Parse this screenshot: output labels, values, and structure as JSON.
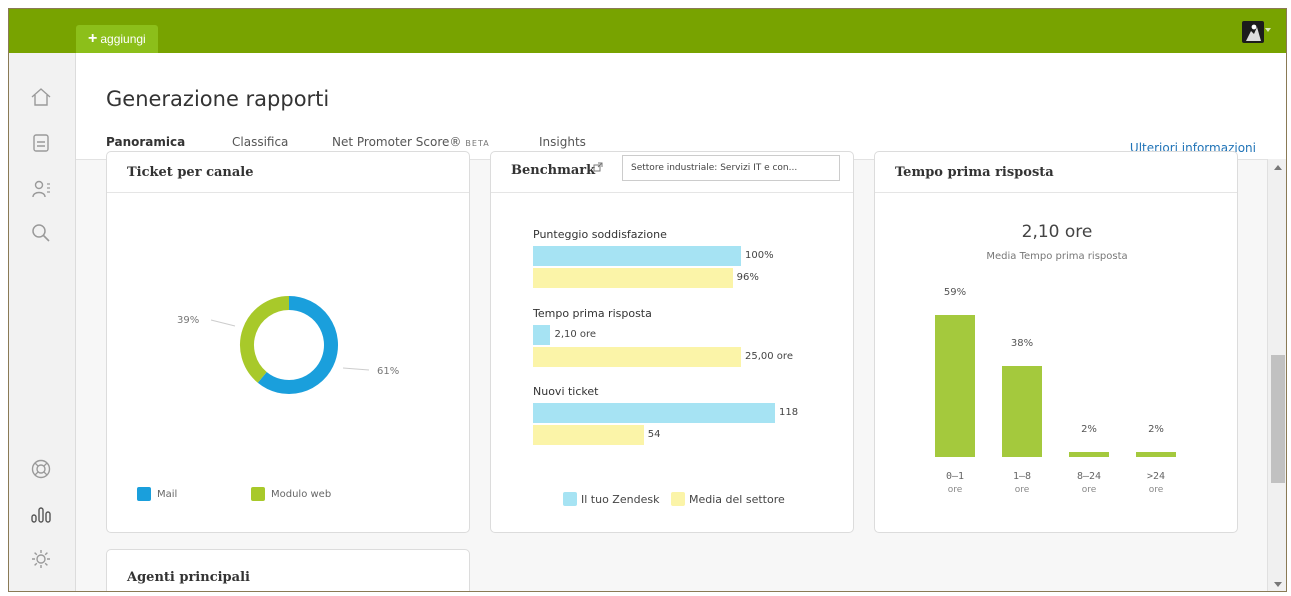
{
  "topbar": {
    "add_label": "aggiungi",
    "color": "#78a300"
  },
  "sidebar": {
    "icons": [
      "home-icon",
      "tickets-icon",
      "users-icon",
      "search-icon",
      "help-icon",
      "reports-icon",
      "settings-icon"
    ]
  },
  "page": {
    "title": "Generazione rapporti",
    "more_link": "Ulteriori informazioni"
  },
  "tabs": [
    {
      "label": "Panoramica",
      "active": true
    },
    {
      "label": "Classifica"
    },
    {
      "label": "Net Promoter Score®",
      "badge": "BETA"
    },
    {
      "label": "Insights"
    }
  ],
  "colors": {
    "mail": "#1a9fdc",
    "web": "#a8c92a",
    "yours": "#a6e3f3",
    "sector": "#fbf4a8",
    "bars": "#a4c93d"
  },
  "cards": {
    "channel": {
      "title": "Ticket per canale",
      "legend": [
        "Mail",
        "Modulo web"
      ],
      "chart_data": {
        "type": "pie",
        "categories": [
          "Mail",
          "Modulo web"
        ],
        "values": [
          61,
          39
        ],
        "labels": [
          "61%",
          "39%"
        ]
      }
    },
    "benchmark": {
      "title": "Benchmark",
      "dropdown": "Settore industriale: Servizi IT e con...",
      "legend": [
        "Il tuo Zendesk",
        "Media del settore"
      ],
      "chart_data": {
        "type": "bar",
        "groups": [
          {
            "label": "Punteggio soddisfazione",
            "yours": 100,
            "sector": 96,
            "yours_label": "100%",
            "sector_label": "96%"
          },
          {
            "label": "Tempo prima risposta",
            "yours": 2.1,
            "sector": 25.0,
            "yours_label": "2,10 ore",
            "sector_label": "25,00 ore"
          },
          {
            "label": "Nuovi ticket",
            "yours": 118,
            "sector": 54,
            "yours_label": "118",
            "sector_label": "54"
          }
        ]
      }
    },
    "response": {
      "title": "Tempo prima risposta",
      "value": "2,10 ore",
      "subtitle": "Media Tempo prima risposta",
      "chart_data": {
        "type": "bar",
        "categories": [
          "0–1",
          "1–8",
          "8–24",
          ">24"
        ],
        "unit": "ore",
        "values": [
          59,
          38,
          2,
          2
        ],
        "labels": [
          "59%",
          "38%",
          "2%",
          "2%"
        ]
      }
    },
    "agents": {
      "title": "Agenti principali"
    }
  }
}
